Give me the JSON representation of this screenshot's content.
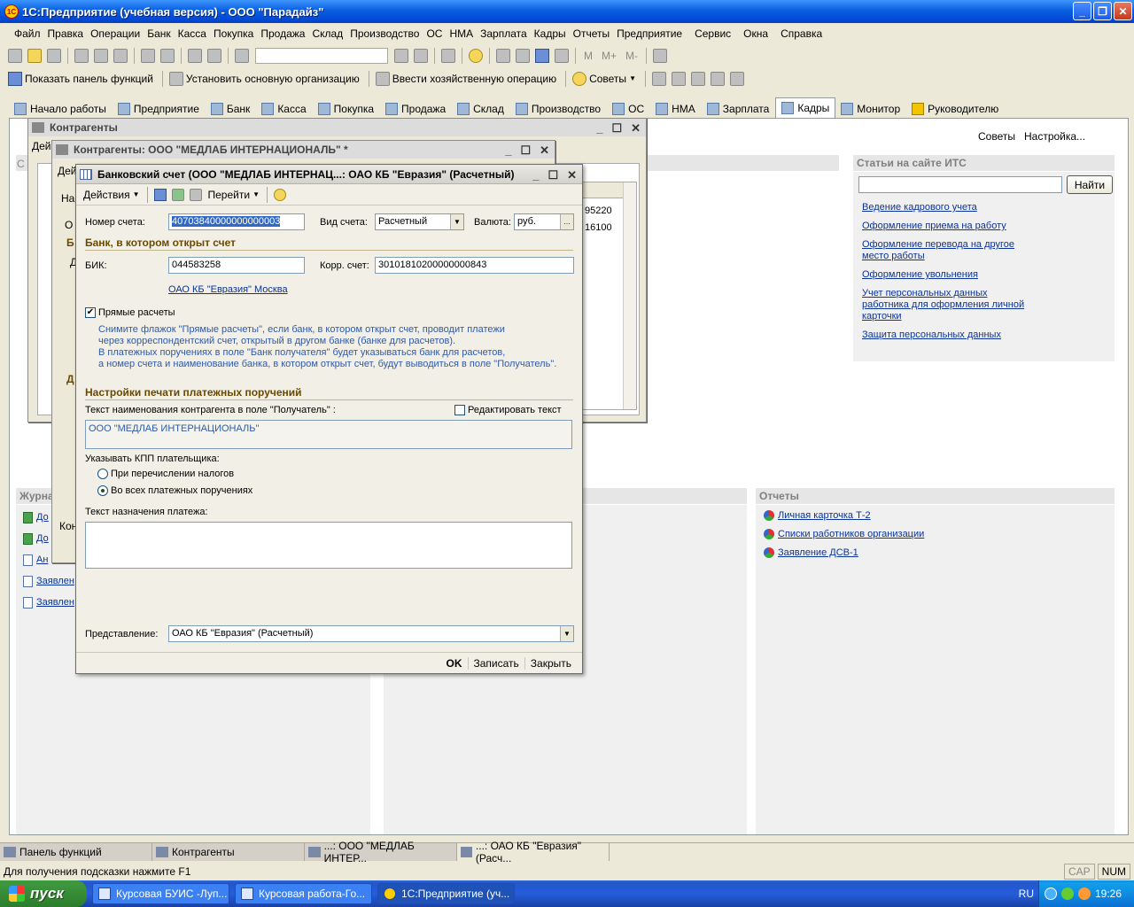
{
  "window": {
    "title": "1С:Предприятие (учебная версия) - ООО \"Парадайз\"",
    "logo": "1С"
  },
  "menu": [
    "Файл",
    "Правка",
    "Операции",
    "Банк",
    "Касса",
    "Покупка",
    "Продажа",
    "Склад",
    "Производство",
    "ОС",
    "НМА",
    "Зарплата",
    "Кадры",
    "Отчеты",
    "Предприятие",
    "Сервис",
    "Окна",
    "Справка"
  ],
  "toolbar2": {
    "show_panel": "Показать панель функций",
    "set_org": "Установить основную организацию",
    "enter_op": "Ввести хозяйственную операцию",
    "tips": "Советы"
  },
  "toolbar1": {
    "m": "M",
    "mplus": "M+",
    "mminus": "M-"
  },
  "section_tabs": [
    {
      "label": "Начало работы"
    },
    {
      "label": "Предприятие"
    },
    {
      "label": "Банк"
    },
    {
      "label": "Касса"
    },
    {
      "label": "Покупка"
    },
    {
      "label": "Продажа"
    },
    {
      "label": "Склад"
    },
    {
      "label": "Производство"
    },
    {
      "label": "ОС"
    },
    {
      "label": "НМА"
    },
    {
      "label": "Зарплата"
    },
    {
      "label": "Кадры"
    },
    {
      "label": "Монитор"
    },
    {
      "label": "Руководителю"
    }
  ],
  "right_top": {
    "tips": "Советы",
    "settings": "Настройка..."
  },
  "its": {
    "title": "Статьи на сайте ИТС",
    "find_button": "Найти",
    "links": [
      "Ведение кадрового учета",
      "Оформление приема на работу",
      "Оформление перевода на другое место работы",
      "Оформление увольнения",
      "Учет персональных данных работника для оформления личной карточки",
      "Защита персональных данных"
    ]
  },
  "journal": {
    "title": "Журна",
    "links": [
      "До",
      "До",
      "Ан",
      "Заявлен",
      "Заявлен"
    ]
  },
  "reports": {
    "title": "Отчеты",
    "links": [
      "Личная карточка Т-2",
      "Списки работников организации",
      "Заявление ДСВ-1"
    ]
  },
  "bg_window1": {
    "title": "Контрагенты",
    "frag1": "Дей",
    "frag2": "Ко",
    "frag3": "С"
  },
  "bg_window2": {
    "title": "Контрагенты: ООО \"МЕДЛАБ ИНТЕРНАЦИОНАЛЬ\" *",
    "frag_actions": "Дей",
    "frag_na": "На",
    "frag_o": "О",
    "frag_b": "Б",
    "frag_d": "Д",
    "frag_d2": "Д",
    "frag_kon": "Кон",
    "cells": [
      "95220",
      "16100"
    ]
  },
  "dialog": {
    "title": "Банковский счет (ООО \"МЕДЛАБ ИНТЕРНАЦ...: ОАО КБ \"Евразия\" (Расчетный)",
    "toolbar": {
      "actions": "Действия",
      "goto": "Перейти"
    },
    "account_number_label": "Номер счета:",
    "account_number": "40703840000000000003",
    "account_type_label": "Вид счета:",
    "account_type": "Расчетный",
    "currency_label": "Валюта:",
    "currency": "руб.",
    "bank_section": "Банк, в котором открыт счет",
    "bik_label": "БИК:",
    "bik": "044583258",
    "corr_label": "Корр. счет:",
    "corr": "30101810200000000843",
    "bank_link": "ОАО КБ \"Евразия\" Москва",
    "direct_label": "Прямые расчеты",
    "hint_lines": [
      "Снимите флажок \"Прямые расчеты\", если банк, в котором открыт счет, проводит платежи",
      "через корреспондентский счет, открытый в другом банке (банке для расчетов).",
      "В платежных поручениях в поле \"Банк получателя\" будет указываться банк для расчетов,",
      "а номер счета и наименование банка, в котором открыт счет, будут выводиться в поле \"Получатель\"."
    ],
    "print_section": "Настройки печати платежных поручений",
    "recipient_text_label": "Текст наименования контрагента в поле \"Получатель\" :",
    "edit_text_label": "Редактировать текст",
    "recipient_text": "ООО \"МЕДЛАБ ИНТЕРНАЦИОНАЛЬ\"",
    "kpp_label": "Указывать КПП плательщика:",
    "kpp_opt1": "При перечислении налогов",
    "kpp_opt2": "Во всех платежных поручениях",
    "purpose_label": "Текст назначения платежа:",
    "purpose_text": "",
    "repr_label": "Представление:",
    "repr": "ОАО КБ \"Евразия\" (Расчетный)",
    "footer": {
      "ok": "OK",
      "save": "Записать",
      "close": "Закрыть"
    }
  },
  "window_bar": [
    "Панель функций",
    "Контрагенты",
    "...: ООО \"МЕДЛАБ ИНТЕР...",
    "...: ОАО КБ \"Евразия\" (Расч..."
  ],
  "status": {
    "hint": "Для получения подсказки нажмите F1",
    "cap": "CAP",
    "num": "NUM"
  },
  "taskbar": {
    "start": "пуск",
    "tasks": [
      "Курсовая БУИС -Луп...",
      "Курсовая работа-Го...",
      "1С:Предприятие (уч..."
    ],
    "lang": "RU",
    "time": "19:26"
  }
}
